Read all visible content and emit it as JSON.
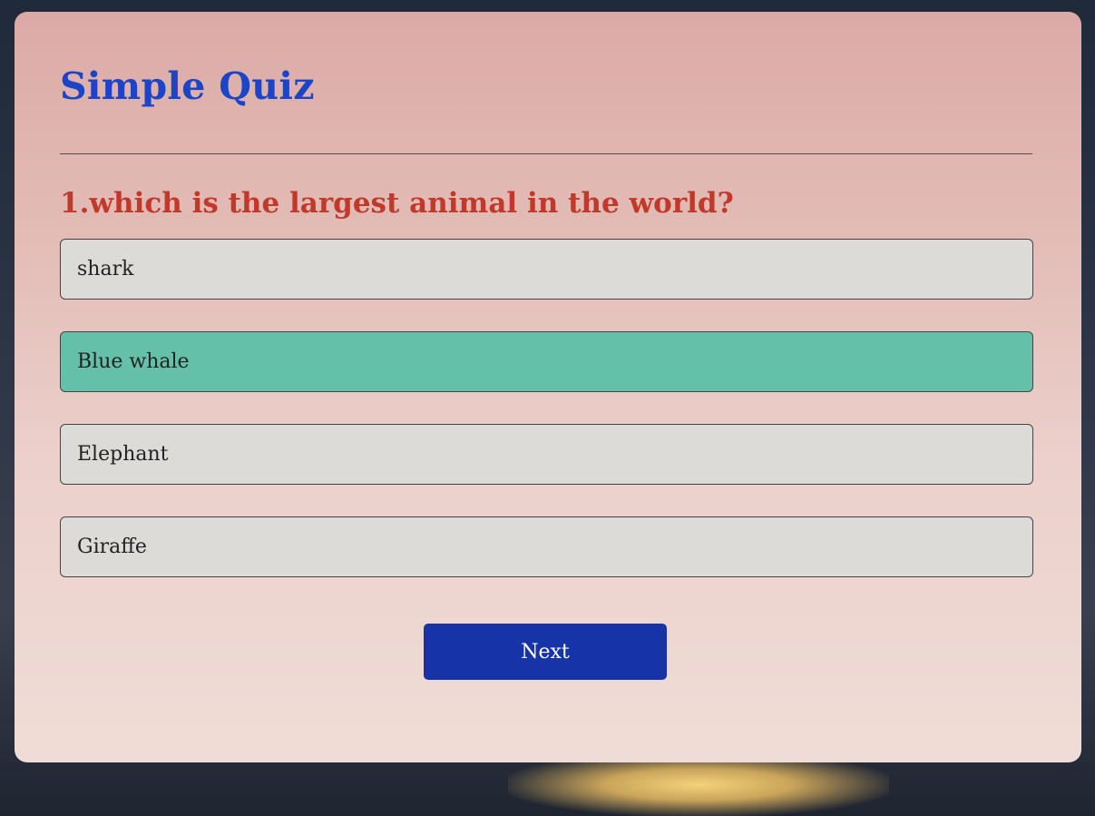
{
  "quiz": {
    "title": "Simple Quiz",
    "question": "1.which is the largest animal in the world?",
    "answers": [
      {
        "label": "shark",
        "selected": false
      },
      {
        "label": "Blue whale",
        "selected": true
      },
      {
        "label": "Elephant",
        "selected": false
      },
      {
        "label": "Giraffe",
        "selected": false
      }
    ],
    "next_label": "Next"
  },
  "colors": {
    "title": "#1c44c8",
    "question": "#c0392b",
    "selected_answer": "#64c0a8",
    "button": "#1634a8"
  }
}
